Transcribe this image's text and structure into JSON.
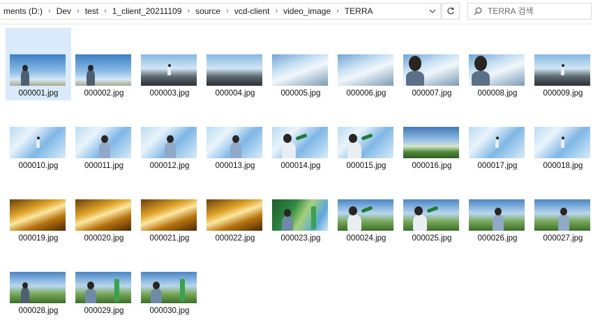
{
  "address_bar": {
    "crumbs": [
      "ments (D:)",
      "Dev",
      "test",
      "1_client_20211109",
      "source",
      "vcd-client",
      "video_image",
      "TERRA"
    ],
    "separator": "›"
  },
  "search": {
    "placeholder": "TERRA 검색"
  },
  "files": [
    {
      "name": "000001.jpg",
      "style": "sky",
      "figure": "left",
      "selected": true
    },
    {
      "name": "000002.jpg",
      "style": "sky",
      "figure": "left"
    },
    {
      "name": "000003.jpg",
      "style": "rock",
      "figure": "small"
    },
    {
      "name": "000004.jpg",
      "style": "rock",
      "figure": "none"
    },
    {
      "name": "000005.jpg",
      "style": "cloud",
      "figure": "none"
    },
    {
      "name": "000006.jpg",
      "style": "cloud",
      "figure": "none"
    },
    {
      "name": "000007.jpg",
      "style": "cloud",
      "figure": "face"
    },
    {
      "name": "000008.jpg",
      "style": "cloud",
      "figure": "face"
    },
    {
      "name": "000009.jpg",
      "style": "rock",
      "figure": "small"
    },
    {
      "name": "000010.jpg",
      "style": "splash",
      "figure": "small"
    },
    {
      "name": "000011.jpg",
      "style": "splash",
      "figure": "center"
    },
    {
      "name": "000012.jpg",
      "style": "splash",
      "figure": "center"
    },
    {
      "name": "000013.jpg",
      "style": "splash",
      "figure": "center"
    },
    {
      "name": "000014.jpg",
      "style": "splash",
      "figure": "drink"
    },
    {
      "name": "000015.jpg",
      "style": "splash",
      "figure": "drink"
    },
    {
      "name": "000016.jpg",
      "style": "field",
      "figure": "none"
    },
    {
      "name": "000017.jpg",
      "style": "splash",
      "figure": "small"
    },
    {
      "name": "000018.jpg",
      "style": "splash",
      "figure": "small"
    },
    {
      "name": "000019.jpg",
      "style": "gold",
      "figure": "none"
    },
    {
      "name": "000020.jpg",
      "style": "gold",
      "figure": "none"
    },
    {
      "name": "000021.jpg",
      "style": "gold",
      "figure": "none"
    },
    {
      "name": "000022.jpg",
      "style": "gold",
      "figure": "none"
    },
    {
      "name": "000023.jpg",
      "style": "bottle",
      "figure": "bottle"
    },
    {
      "name": "000024.jpg",
      "style": "meadow",
      "figure": "drink"
    },
    {
      "name": "000025.jpg",
      "style": "meadow",
      "figure": "drink"
    },
    {
      "name": "000026.jpg",
      "style": "meadow",
      "figure": "center"
    },
    {
      "name": "000027.jpg",
      "style": "meadow",
      "figure": "center"
    },
    {
      "name": "000028.jpg",
      "style": "meadow",
      "figure": "left"
    },
    {
      "name": "000029.jpg",
      "style": "meadow",
      "figure": "bottle"
    },
    {
      "name": "000030.jpg",
      "style": "meadow",
      "figure": "bottle"
    }
  ]
}
